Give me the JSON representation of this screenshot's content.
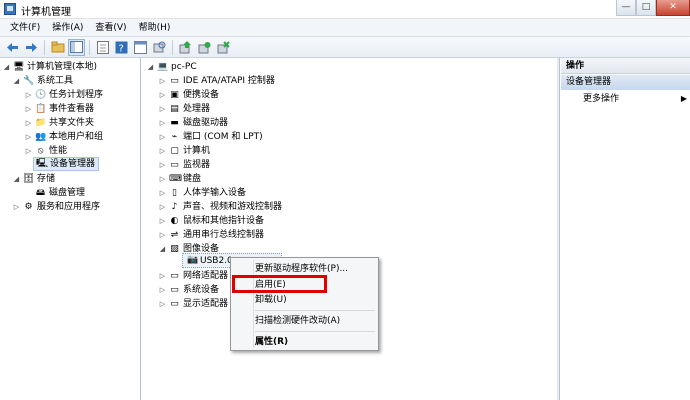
{
  "window": {
    "title": "计算机管理",
    "buttons": {
      "minimize": "—",
      "maximize": "□",
      "close": "✕"
    }
  },
  "menubar": [
    {
      "label": "文件(F)"
    },
    {
      "label": "操作(A)"
    },
    {
      "label": "查看(V)"
    },
    {
      "label": "帮助(H)"
    }
  ],
  "toolbar": {
    "icons": [
      "back-arrow-icon",
      "forward-arrow-icon",
      "up-folder-icon",
      "show-hide-tree-icon",
      "properties-icon",
      "help-icon",
      "help-window-icon",
      "scan-hardware-icon",
      "update-driver-icon",
      "disable-device-icon"
    ]
  },
  "left_tree": {
    "root": "计算机管理(本地)",
    "system_tools": "系统工具",
    "task_scheduler": "任务计划程序",
    "event_viewer": "事件查看器",
    "shared_folders": "共享文件夹",
    "local_users": "本地用户和组",
    "performance": "性能",
    "device_manager": "设备管理器",
    "storage": "存储",
    "disk_management": "磁盘管理",
    "services_apps": "服务和应用程序"
  },
  "device_tree": {
    "computer": "pc-PC",
    "categories": [
      "IDE ATA/ATAPI 控制器",
      "便携设备",
      "处理器",
      "磁盘驱动器",
      "端口 (COM 和 LPT)",
      "计算机",
      "监视器",
      "键盘",
      "人体学输入设备",
      "声音、视频和游戏控制器",
      "鼠标和其他指针设备",
      "通用串行总线控制器",
      "图像设备"
    ],
    "selected_device": "USB2.0",
    "after": [
      "网络适配器",
      "系统设备",
      "显示适配器"
    ]
  },
  "actions": {
    "header": "操作",
    "section": "设备管理器",
    "more": "更多操作"
  },
  "context_menu": {
    "update_driver": "更新驱动程序软件(P)...",
    "enable": "启用(E)",
    "uninstall": "卸载(U)",
    "scan": "扫描检测硬件改动(A)",
    "properties": "属性(R)"
  },
  "colors": {
    "highlight_box": "#e00000",
    "selection": "#dde9f6"
  }
}
